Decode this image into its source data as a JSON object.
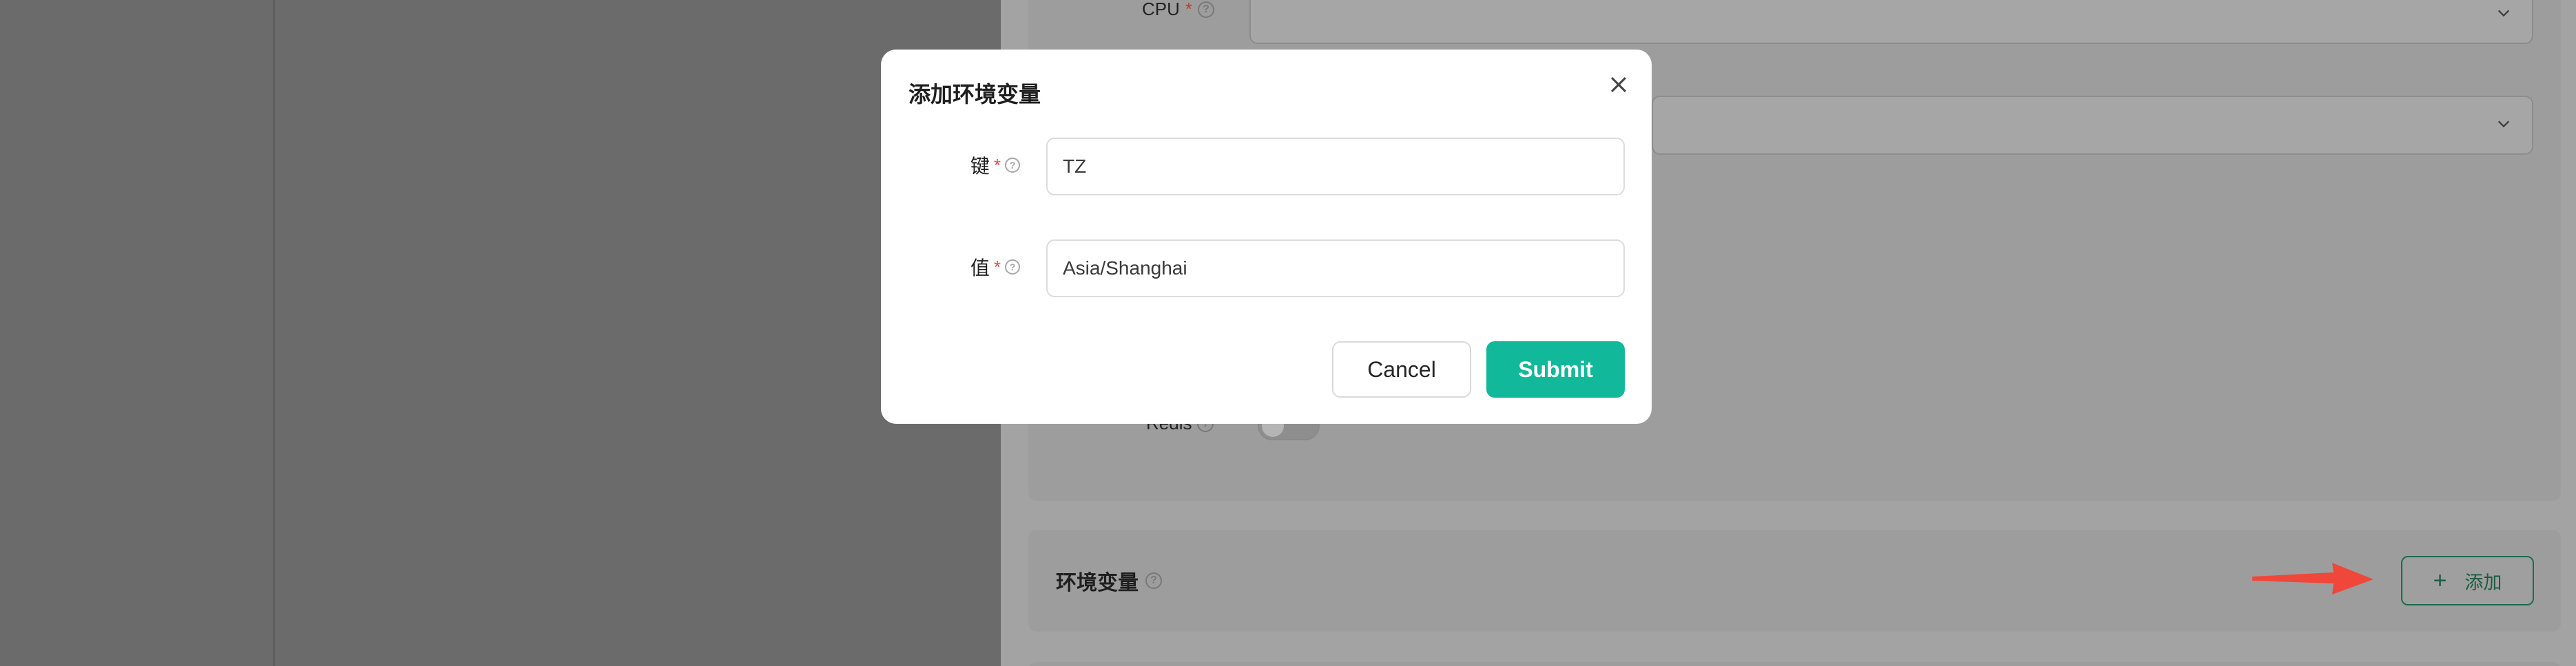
{
  "background": {
    "fields": {
      "cpu_label": "CPU",
      "redis_label": "Redis"
    },
    "env_section": {
      "title": "环境变量",
      "add_label": "添加"
    }
  },
  "modal": {
    "title": "添加环境变量",
    "key_field": {
      "label": "键",
      "value": "TZ"
    },
    "value_field": {
      "label": "值",
      "value": "Asia/Shanghai"
    },
    "cancel_label": "Cancel",
    "submit_label": "Submit"
  },
  "colors": {
    "primary": "#12b89a",
    "required": "#e5484d",
    "annotation_arrow": "#f0473b"
  },
  "icons": {
    "close": "close-icon",
    "help": "question-circle-icon",
    "plus": "plus-icon",
    "dropdown": "chevron-down-icon"
  }
}
